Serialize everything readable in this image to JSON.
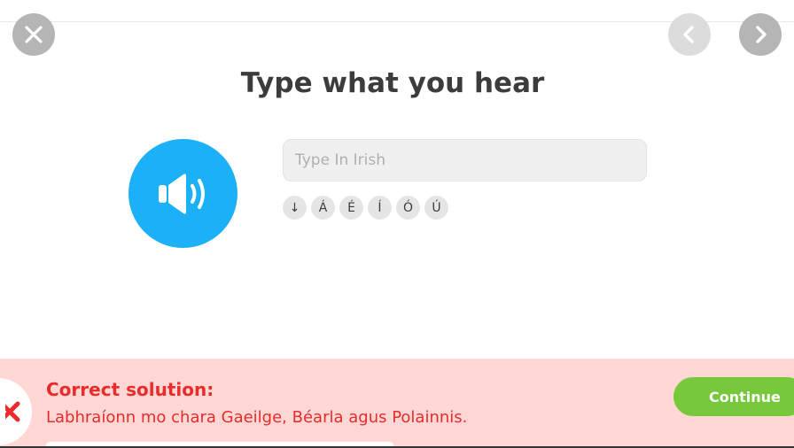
{
  "header": {
    "close_icon": "close-icon",
    "prev_icon": "chevron-left-icon",
    "next_icon": "chevron-right-icon"
  },
  "exercise": {
    "title": "Type what you hear",
    "speaker_icon": "speaker-icon",
    "input_placeholder": "Type In Irish",
    "input_value": "",
    "special_keys": [
      "↓",
      "Á",
      "É",
      "Í",
      "Ó",
      "Ú"
    ]
  },
  "feedback": {
    "icon": "cross-icon",
    "heading": "Correct solution:",
    "solution": "Labhraíonn mo chara Gaeilge, Béarla agus Polainnis.",
    "continue_label": "Continue"
  },
  "colors": {
    "accent_blue": "#1cb0f6",
    "error_red": "#ea2b2b",
    "banner_bg": "#ffd7d4",
    "continue_green": "#78c83c"
  }
}
